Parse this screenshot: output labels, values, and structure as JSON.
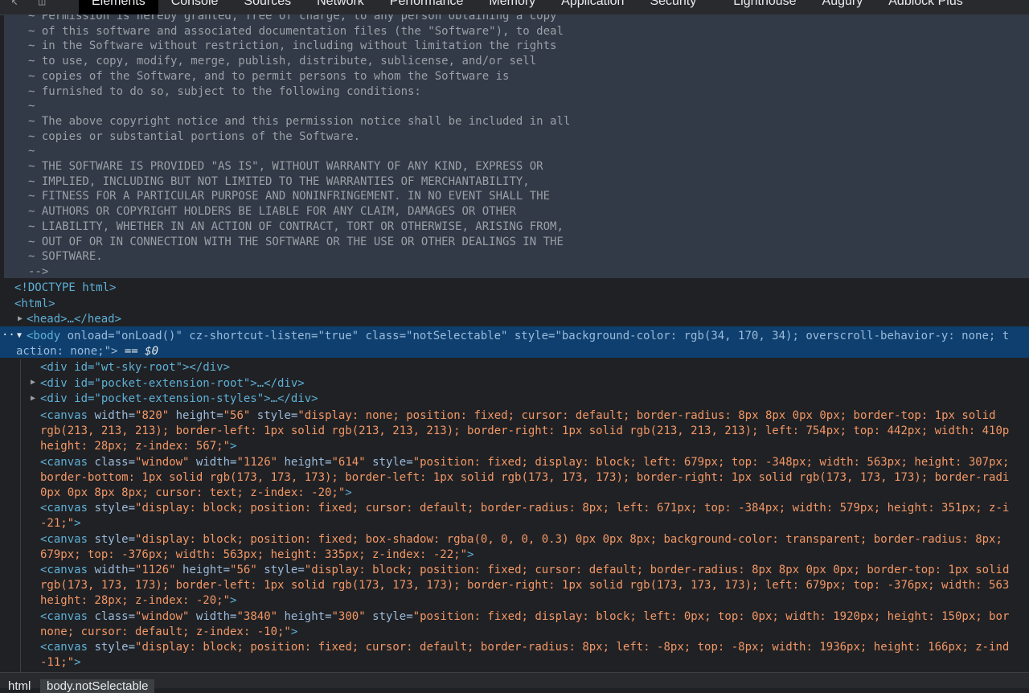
{
  "tabs": [
    "Elements",
    "Console",
    "Sources",
    "Network",
    "Performance",
    "Memory",
    "Application",
    "Security",
    "Lighthouse",
    "Augury",
    "Adblock Plus"
  ],
  "comment_lines": [
    "~ Permission is hereby granted, free of charge, to any person obtaining a copy",
    "~ of this software and associated documentation files (the \"Software\"), to deal",
    "~ in the Software without restriction, including without limitation the rights",
    "~ to use, copy, modify, merge, publish, distribute, sublicense, and/or sell",
    "~ copies of the Software, and to permit persons to whom the Software is",
    "~ furnished to do so, subject to the following conditions:",
    "~",
    "~ The above copyright notice and this permission notice shall be included in all",
    "~ copies or substantial portions of the Software.",
    "~",
    "~ THE SOFTWARE IS PROVIDED \"AS IS\", WITHOUT WARRANTY OF ANY KIND, EXPRESS OR",
    "~ IMPLIED, INCLUDING BUT NOT LIMITED TO THE WARRANTIES OF MERCHANTABILITY,",
    "~ FITNESS FOR A PARTICULAR PURPOSE AND NONINFRINGEMENT. IN NO EVENT SHALL THE",
    "~ AUTHORS OR COPYRIGHT HOLDERS BE LIABLE FOR ANY CLAIM, DAMAGES OR OTHER",
    "~ LIABILITY, WHETHER IN AN ACTION OF CONTRACT, TORT OR OTHERWISE, ARISING FROM,",
    "~ OUT OF OR IN CONNECTION WITH THE SOFTWARE OR THE USE OR OTHER DEALINGS IN THE",
    "~ SOFTWARE.",
    "-->"
  ],
  "doctype": "<!DOCTYPE html>",
  "html_tag": "<html>",
  "head_tag": "<head>…</head>",
  "body": {
    "open": "<body",
    "attrs": " onload=\"onLoad()\" cz-shortcut-listen=\"true\" class=\"notSelectable\" style=\"background-color: rgb(34, 170, 34); overscroll-behavior-y: none; t",
    "line2": "action: none;\">",
    "marker": " == $0"
  },
  "children": [
    "<div id=\"wt-sky-root\"></div>",
    "<div id=\"pocket-extension-root\">…</div>",
    "<div id=\"pocket-extension-styles\">…</div>"
  ],
  "canvas_lines": [
    "<canvas width=\"820\" height=\"56\" style=\"display: none; position: fixed; cursor: default; border-radius: 8px 8px 0px 0px; border-top: 1px solid",
    "rgb(213, 213, 213); border-left: 1px solid rgb(213, 213, 213); border-right: 1px solid rgb(213, 213, 213); left: 754px; top: 442px; width: 410p",
    "height: 28px; z-index: 567;\">",
    "<canvas class=\"window\" width=\"1126\" height=\"614\" style=\"position: fixed; display: block; left: 679px; top: -348px; width: 563px; height: 307px;",
    "border-bottom: 1px solid rgb(173, 173, 173); border-left: 1px solid rgb(173, 173, 173); border-right: 1px solid rgb(173, 173, 173); border-radi",
    "0px 0px 8px 8px; cursor: text; z-index: -20;\">",
    "<canvas style=\"display: block; position: fixed; cursor: default; border-radius: 8px; left: 671px; top: -384px; width: 579px; height: 351px; z-i",
    "-21;\">",
    "<canvas style=\"display: block; position: fixed; box-shadow: rgba(0, 0, 0, 0.3) 0px 0px 8px; background-color: transparent; border-radius: 8px;",
    "679px; top: -376px; width: 563px; height: 335px; z-index: -22;\">",
    "<canvas width=\"1126\" height=\"56\" style=\"display: block; position: fixed; cursor: default; border-radius: 8px 8px 0px 0px; border-top: 1px solid",
    "rgb(173, 173, 173); border-left: 1px solid rgb(173, 173, 173); border-right: 1px solid rgb(173, 173, 173); left: 679px; top: -376px; width: 563",
    "height: 28px; z-index: -20;\">",
    "<canvas class=\"window\" width=\"3840\" height=\"300\" style=\"position: fixed; display: block; left: 0px; top: 0px; width: 1920px; height: 150px; bor",
    "none; cursor: default; z-index: -10;\">",
    "<canvas style=\"display: block; position: fixed; cursor: default; border-radius: 8px; left: -8px; top: -8px; width: 1936px; height: 166px; z-ind",
    "-11;\">"
  ],
  "breadcrumbs": [
    "html",
    "body.notSelectable"
  ],
  "colors": {
    "selection": "#0e3f6e",
    "comment_bg": "#323a47",
    "tag": "#5db0d7",
    "value": "#f29766"
  }
}
